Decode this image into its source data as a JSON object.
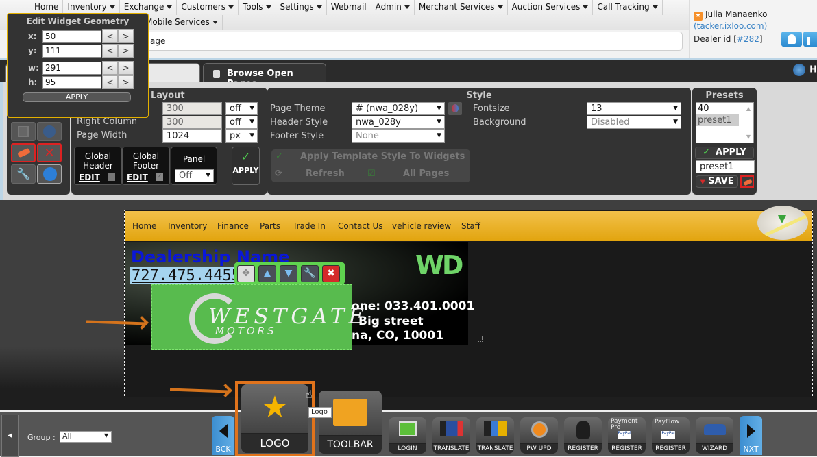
{
  "topnav": {
    "row1": [
      {
        "label": "Home",
        "dropdown": false
      },
      {
        "label": "Inventory",
        "dropdown": true
      },
      {
        "label": "Exchange",
        "dropdown": true
      },
      {
        "label": "Customers",
        "dropdown": true
      },
      {
        "label": "Tools",
        "dropdown": true
      },
      {
        "label": "Settings",
        "dropdown": true
      },
      {
        "label": "Webmail",
        "dropdown": false
      },
      {
        "label": "Admin",
        "dropdown": true
      },
      {
        "label": "Merchant Services",
        "dropdown": true
      },
      {
        "label": "Auction Services",
        "dropdown": true
      },
      {
        "label": "Call Tracking",
        "dropdown": true
      }
    ],
    "row2": [
      {
        "label": "Mobile Services",
        "dropdown": true
      }
    ],
    "url_fragment": "age"
  },
  "user": {
    "name": "Julia Manaenko",
    "host": "(tacker.ixloo.com)",
    "dealer_label": "Dealer id",
    "dealer_id": "#282"
  },
  "tabs": {
    "browse_open_pages": "Browse Open Pages",
    "right_label": "H"
  },
  "geometry": {
    "title": "Edit Widget Geometry",
    "fields": [
      {
        "label": "x:",
        "value": "50"
      },
      {
        "label": "y:",
        "value": "111"
      },
      {
        "label": "w:",
        "value": "291"
      },
      {
        "label": "h:",
        "value": "95"
      }
    ],
    "dec": "<",
    "inc": ">",
    "apply": "APPLY"
  },
  "layout": {
    "title": "Layout",
    "left_column_value": "300",
    "left_column_mode": "off",
    "right_column_label": "Right Column",
    "right_column_value": "300",
    "right_column_mode": "off",
    "page_width_label": "Page Width",
    "page_width_value": "1024",
    "page_width_unit": "px",
    "global_header": "Global Header",
    "global_footer": "Global Footer",
    "edit": "EDIT",
    "global_header_checked": false,
    "global_footer_checked": true,
    "panel_label": "Panel",
    "panel_value": "Off",
    "apply": "APPLY"
  },
  "style": {
    "title": "Style",
    "page_theme_label": "Page Theme",
    "page_theme_value": "# (nwa_028y)",
    "header_style_label": "Header Style",
    "header_style_value": "nwa_028y",
    "footer_style_label": "Footer Style",
    "footer_style_value": "None",
    "fontsize_label": "Fontsize",
    "fontsize_value": "13",
    "background_label": "Background",
    "background_value": "Disabled",
    "apply_template": "Apply Template Style To Widgets",
    "refresh": "Refresh",
    "all_pages": "All Pages"
  },
  "presets": {
    "title": "Presets",
    "list": [
      "40",
      "preset1"
    ],
    "selected": "preset1",
    "apply": "APPLY",
    "name_value": "preset1",
    "save": "SAVE"
  },
  "site": {
    "nav": [
      "Home",
      "Inventory",
      "Finance",
      "Parts",
      "Trade In",
      "Contact Us",
      "vehicle review",
      "Staff"
    ],
    "dealership_name": "Dealership Name",
    "phone": "727.475.4455",
    "banner_logo": "WD",
    "banner_phone": "one: 033.401.0001",
    "banner_street": "Big street",
    "banner_city": "na, CO, 10001",
    "logo_text1": "ESTGATE",
    "logo_initial": "W",
    "logo_text2": "OTORS",
    "logo_initial2": "M"
  },
  "bottom": {
    "group_label": "Group :",
    "group_value": "All",
    "back": "BCK",
    "next": "NXT",
    "tooltip": "Logo",
    "widgets": [
      {
        "label": "LOGO",
        "icon": "lightbulb-star-icon"
      },
      {
        "label": "TOOLBAR",
        "icon": "toolbox-icon"
      },
      {
        "label": "LOGIN",
        "icon": "key-icon"
      },
      {
        "label": "TRANSLATE",
        "icon": "flags-icon"
      },
      {
        "label": "TRANSLATE",
        "icon": "google-translate-icon"
      },
      {
        "label": "PW UPD",
        "icon": "lock-refresh-icon"
      },
      {
        "label": "REGISTER",
        "icon": "user-add-icon"
      },
      {
        "label": "REGISTER",
        "icon": "paypal-pro-icon",
        "sub": "Payment Pro"
      },
      {
        "label": "REGISTER",
        "icon": "payflow-icon",
        "sub": "PayFlow"
      },
      {
        "label": "WIZARD",
        "icon": "wizard-car-icon"
      }
    ]
  },
  "colors": {
    "accent_orange": "#e0731c",
    "widget_green": "#58bb4e",
    "site_nav_gold": "#e8ae1c",
    "link_blue": "#3a83c5"
  }
}
